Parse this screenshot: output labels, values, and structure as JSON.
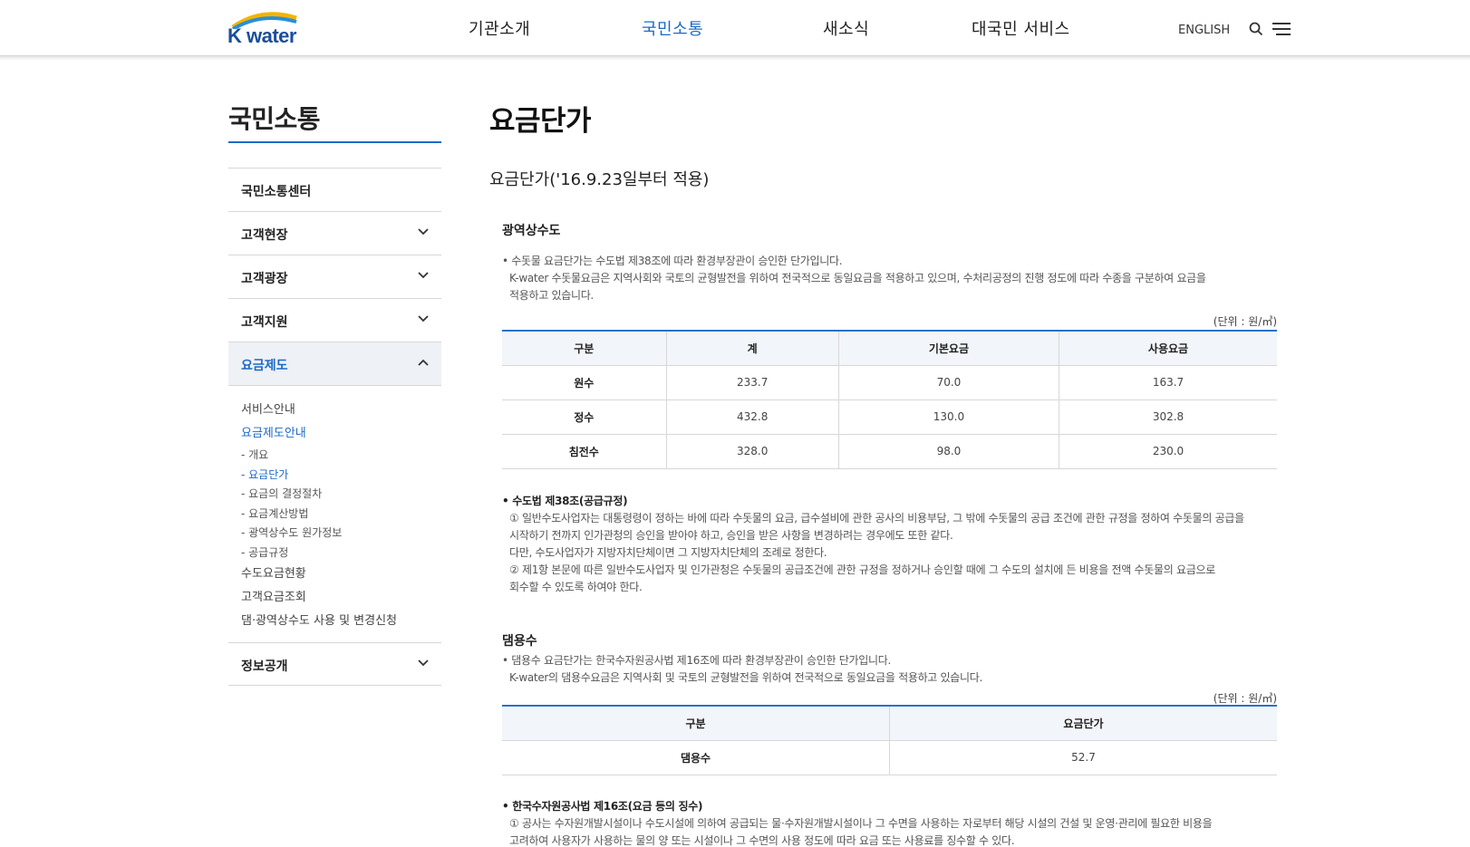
{
  "header": {
    "logo_text": "K water",
    "nav": [
      "기관소개",
      "국민소통",
      "새소식",
      "대국민 서비스"
    ],
    "english": "ENGLISH",
    "colors": {
      "brand": "#1a4e9b",
      "accent": "#1c69c7"
    }
  },
  "sidebar": {
    "title": "국민소통",
    "items": [
      {
        "label": "국민소통센터"
      },
      {
        "label": "고객현장"
      },
      {
        "label": "고객광장"
      },
      {
        "label": "고객지원"
      },
      {
        "label": "요금제도"
      }
    ],
    "sub": {
      "links_top": [
        "서비스안내",
        "요금제도안내"
      ],
      "subsub": [
        "- 개요",
        "- 요금단가",
        "- 요금의 결정절차",
        "- 요금계산방법",
        "- 광역상수도 원가정보",
        "- 공급규정"
      ],
      "links_bottom": [
        "수도요금현황",
        "고객요금조회",
        "댐·광역상수도 사용 및 변경신청"
      ]
    },
    "last_item": "정보공개"
  },
  "content": {
    "page_title": "요금단가",
    "sub_title": "요금단가('16.9.23일부터 적용)",
    "section1": {
      "title": "광역상수도",
      "para": [
        "• 수돗물 요금단가는 수도법 제38조에 따라 환경부장관이 승인한 단가입니다.",
        "K-water 수돗물요금은 지역사회와 국토의 균형발전을 위하여 전국적으로 동일요금을 적용하고 있으며, 수처리공정의 진행 정도에 따라 수종을 구분하여 요금을",
        "적용하고 있습니다."
      ],
      "unit": "(단위 : 원/㎥)",
      "table": {
        "headers": [
          "구분",
          "계",
          "기본요금",
          "사용요금"
        ],
        "rows": [
          [
            "원수",
            "233.7",
            "70.0",
            "163.7"
          ],
          [
            "정수",
            "432.8",
            "130.0",
            "302.8"
          ],
          [
            "침전수",
            "328.0",
            "98.0",
            "230.0"
          ]
        ]
      },
      "law_title": "• 수도법 제38조(공급규정)",
      "law": [
        "① 일반수도사업자는 대통령령이 정하는 바에 따라 수돗물의 요금, 급수설비에 관한 공사의 비용부담, 그 밖에 수돗물의 공급 조건에 관한 규정을 정하여 수돗물의 공급을",
        "시작하기 전까지 인가관청의 승인을 받아야 하고, 승인을 받은 사항을 변경하려는 경우에도 또한 같다.",
        "다만, 수도사업자가 지방자치단체이면 그 지방자치단체의 조례로 정한다.",
        "② 제1항 본문에 따른 일반수도사업자 및 인가관청은 수돗물의 공급조건에 관한 규정을 정하거나 승인할 때에 그 수도의 설치에 든 비용을 전액 수돗물의 요금으로",
        "회수할 수 있도록 하여야 한다."
      ]
    },
    "section2": {
      "title": "댐용수",
      "para": [
        "• 댐용수 요금단가는 한국수자원공사법 제16조에 따라 환경부장관이 승인한 단가입니다.",
        "K-water의 댐용수요금은 지역사회 및 국토의 균형발전을 위하여 전국적으로 동일요금을 적용하고 있습니다."
      ],
      "unit": "(단위 : 원/㎥)",
      "table": {
        "headers": [
          "구분",
          "요금단가"
        ],
        "rows": [
          [
            "댐용수",
            "52.7"
          ]
        ]
      },
      "law_title": "• 한국수자원공사법 제16조(요금 등의 징수)",
      "law": [
        "① 공사는 수자원개발시설이나 수도시설에 의하여 공급되는 물·수자원개발시설이나 그 수면을 사용하는 자로부터 해당 시설의 건설 및 운영·관리에 필요한 비용을",
        "고려하여 사용자가 사용하는 물의 양 또는 시설이나 그 수면의 사용 정도에 따라 요금 또는 사용료를 징수할 수 있다."
      ]
    }
  }
}
